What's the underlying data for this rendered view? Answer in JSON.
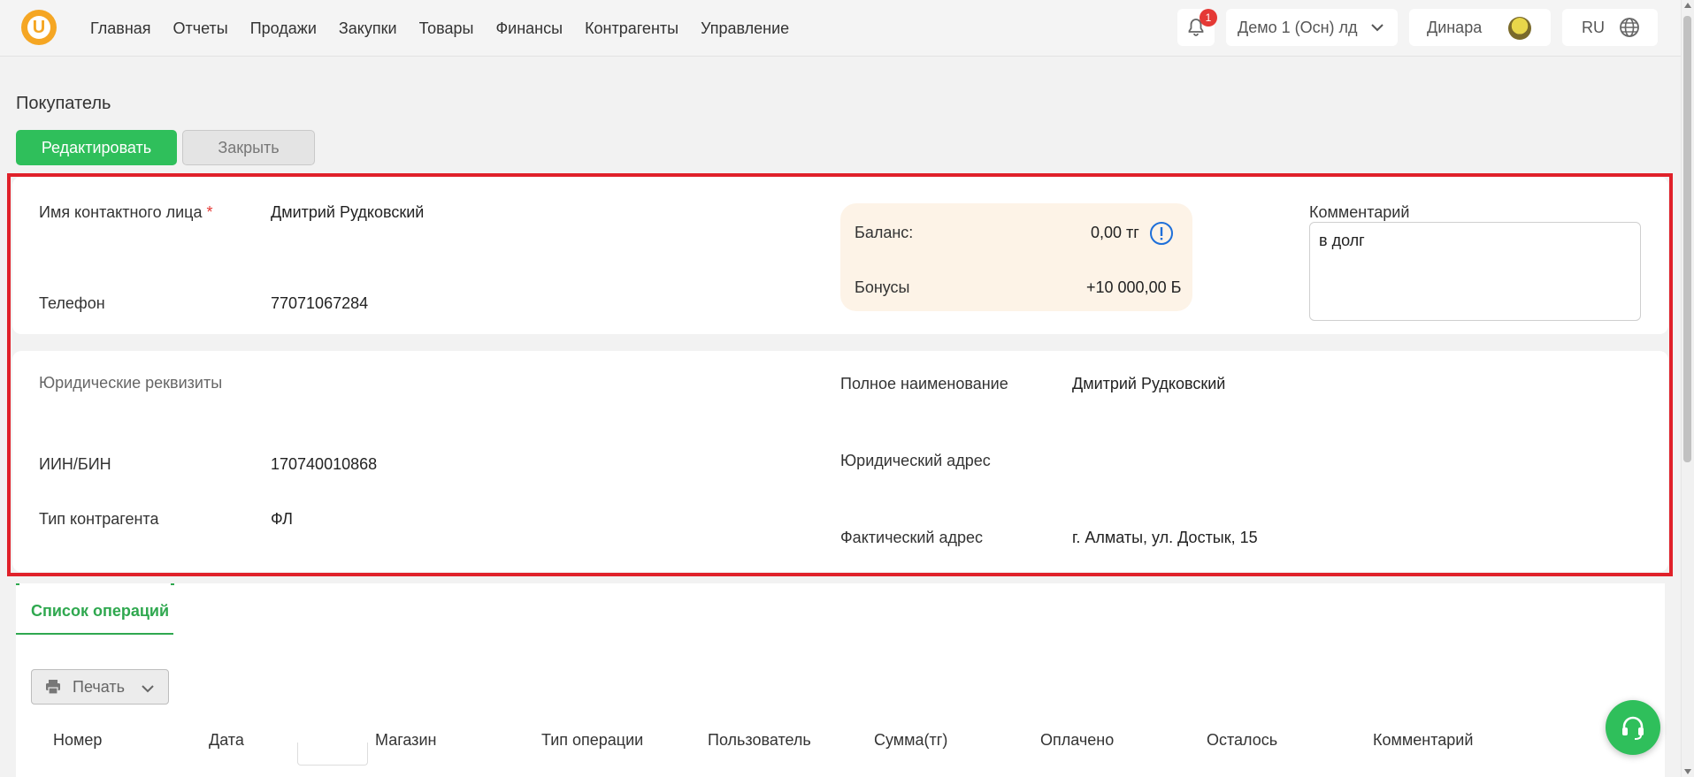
{
  "header": {
    "logo_letter": "U",
    "nav": [
      "Главная",
      "Отчеты",
      "Продажи",
      "Закупки",
      "Товары",
      "Финансы",
      "Контрагенты",
      "Управление"
    ],
    "notifications_count": "1",
    "store": "Демо 1 (Осн) лд",
    "user": "Динара",
    "language": "RU"
  },
  "page": {
    "title": "Покупатель",
    "edit_button": "Редактировать",
    "close_button": "Закрыть"
  },
  "contact": {
    "name_label": "Имя контактного лица",
    "required_mark": "*",
    "name_value": "Дмитрий Рудковский",
    "phone_label": "Телефон",
    "phone_value": "77071067284",
    "balance_label": "Баланс:",
    "balance_value": "0,00 тг",
    "bonus_label": "Бонусы",
    "bonus_value": "+10 000,00 Б",
    "comment_label": "Комментарий",
    "comment_value": "в долг"
  },
  "legal": {
    "section_label": "Юридические реквизиты",
    "iin_label": "ИИН/БИН",
    "iin_value": "170740010868",
    "type_label": "Тип контрагента",
    "type_value": "ФЛ",
    "fullname_label": "Полное наименование",
    "fullname_value": "Дмитрий Рудковский",
    "legal_address_label": "Юридический адрес",
    "legal_address_value": "",
    "actual_address_label": "Фактический адрес",
    "actual_address_value": "г. Алматы, ул. Достык, 15"
  },
  "operations": {
    "tab_label": "Список операций",
    "print_button": "Печать",
    "columns": [
      "Номер",
      "Дата",
      "Магазин",
      "Тип операции",
      "Пользователь",
      "Сумма(тг)",
      "Оплачено",
      "Осталось",
      "Комментарий"
    ]
  },
  "colors": {
    "accent_green": "#2fbf5b",
    "highlight_red": "#e0212a",
    "balance_bg": "#fdf3e7"
  }
}
